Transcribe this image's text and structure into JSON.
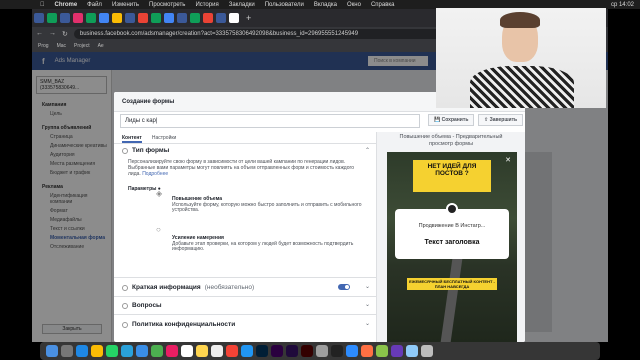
{
  "menubar": {
    "apple": "",
    "app": "Chrome",
    "items": [
      "Файл",
      "Изменить",
      "Просмотреть",
      "История",
      "Закладки",
      "Пользователи",
      "Вкладка",
      "Окно",
      "Справка"
    ],
    "clock": "ср 14:02"
  },
  "browser": {
    "url": "business.facebook.com/adsmanager/creation?act=3335758306492098&business_id=296955551245949",
    "bookmarks": [
      "Prog",
      "Mac",
      "Project",
      "Ae"
    ]
  },
  "fb": {
    "app_title": "Ads Manager",
    "search_placeholder": "Поиск в компании",
    "account": "SMM_BAZ (333575830649...",
    "campaign_section": "Кампания",
    "campaign_items": [
      "Цель"
    ],
    "adset_section": "Группа объявлений",
    "adset_items": [
      "Страница",
      "Динамические креативы",
      "Аудитория",
      "Места размещения",
      "Бюджет и график"
    ],
    "ad_section": "Реклама",
    "ad_items": [
      "Идентификация компании",
      "Формат",
      "Медиафайлы",
      "Текст и ссылки",
      "Моментальная форма",
      "Отслеживание"
    ],
    "close_label": "Закрыть"
  },
  "modal": {
    "title": "Создание формы",
    "form_name": "Лиды с кар|",
    "save_label": "Сохранить",
    "finish_label": "Завершить",
    "tabs": [
      "Контент",
      "Настройки"
    ],
    "form_type": {
      "title": "Тип формы",
      "description": "Персонализируйте свою форму в зависимости от цели вашей кампании по генерации лидов. Выбранные вами параметры могут повлиять на объем отправленных форм и стоимость каждого лида.",
      "link": "Подробнее",
      "params_label": "Параметры",
      "options": [
        {
          "title": "Повышение объема",
          "text": "Используйте форму, которую можно быстро заполнить и отправить с мобильного устройства."
        },
        {
          "title": "Усиление намерения",
          "text": "Добавьте этап проверки, на котором у людей будет возможность подтвердить информацию."
        }
      ]
    },
    "intro": {
      "title": "Краткая информация",
      "optional": "(необязательно)"
    },
    "questions": {
      "title": "Вопросы"
    },
    "privacy": {
      "title": "Политика конфиденциальности"
    },
    "preview": {
      "title": "Повышение объема - Предварительный просмотр формы",
      "banner": "НЕТ ИДЕЙ ДЛЯ ПОСТОВ ?",
      "promo": "ЕЖЕМЕСЯЧНЫЙ БЕСПЛАТНЫЙ КОНТЕНТ - ПЛАН НАВСЕГДА",
      "promoted_from": "Продвижение В Инстагр...",
      "headline": "Текст заголовка",
      "close": "✕"
    }
  },
  "colors": {
    "fb_blue": "#3b5998",
    "accent": "#4267b2",
    "banner_yellow": "#f5d130"
  }
}
